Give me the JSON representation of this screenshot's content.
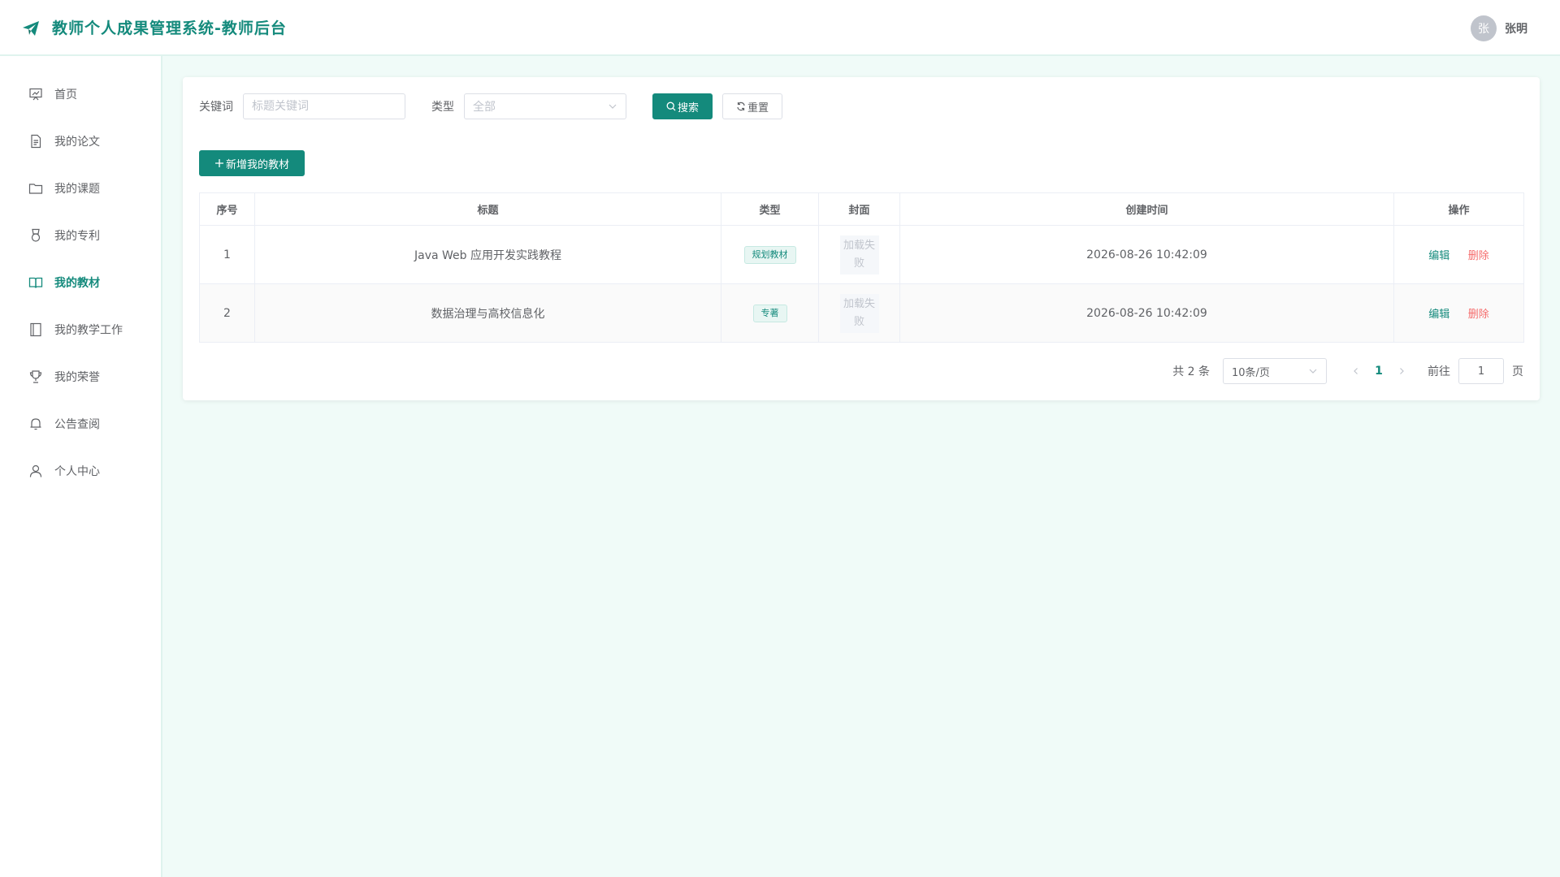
{
  "header": {
    "title": "教师个人成果管理系统-教师后台",
    "avatar_text": "张",
    "user_name": "张明",
    "accent_color": "#148a7c"
  },
  "sidebar": {
    "items": [
      {
        "label": "首页",
        "icon": "presentation-board-icon",
        "active": false
      },
      {
        "label": "我的论文",
        "icon": "document-icon",
        "active": false
      },
      {
        "label": "我的课题",
        "icon": "folder-icon",
        "active": false
      },
      {
        "label": "我的专利",
        "icon": "medal-icon",
        "active": false
      },
      {
        "label": "我的教材",
        "icon": "open-book-icon",
        "active": true
      },
      {
        "label": "我的教学工作",
        "icon": "notebook-icon",
        "active": false
      },
      {
        "label": "我的荣誉",
        "icon": "trophy-icon",
        "active": false
      },
      {
        "label": "公告查阅",
        "icon": "bell-icon",
        "active": false
      },
      {
        "label": "个人中心",
        "icon": "user-icon",
        "active": false
      }
    ]
  },
  "filters": {
    "keyword_label": "关键词",
    "keyword_placeholder": "标题关键词",
    "keyword_value": "",
    "type_label": "类型",
    "type_value": "全部",
    "search_button": "搜索",
    "reset_button": "重置"
  },
  "add_button": "新增我的教材",
  "table": {
    "columns": [
      "序号",
      "标题",
      "类型",
      "封面",
      "创建时间",
      "操作"
    ],
    "rows": [
      {
        "index": "1",
        "title": "Java Web 应用开发实践教程",
        "type": "规划教材",
        "cover": "加载失败",
        "created": "2026-08-26 10:42:09",
        "edit": "编辑",
        "delete": "删除"
      },
      {
        "index": "2",
        "title": "数据治理与高校信息化",
        "type": "专著",
        "cover": "加载失败",
        "created": "2026-08-26 10:42:09",
        "edit": "编辑",
        "delete": "删除"
      }
    ]
  },
  "pagination": {
    "total_text": "共 2 条",
    "page_size": "10条/页",
    "current_page": "1",
    "goto_label": "前往",
    "goto_value": "1",
    "page_suffix": "页"
  }
}
